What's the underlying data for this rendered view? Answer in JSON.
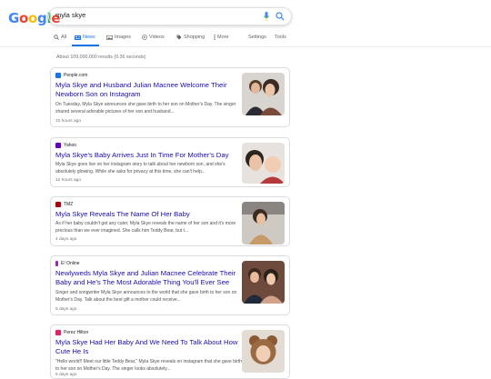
{
  "logo": {
    "letters": [
      "G",
      "o",
      "o",
      "g",
      "l",
      "e"
    ]
  },
  "search": {
    "query": "myla skye"
  },
  "tabs": [
    {
      "label": "All",
      "icon": "search-icon"
    },
    {
      "label": "News",
      "icon": "news-icon"
    },
    {
      "label": "Images",
      "icon": "image-icon"
    },
    {
      "label": "Videos",
      "icon": "video-icon"
    },
    {
      "label": "Shopping",
      "icon": "tag-icon"
    },
    {
      "label": "More",
      "icon": "more-dots-icon"
    },
    {
      "label": "Settings"
    },
    {
      "label": "Tools"
    }
  ],
  "colors": {
    "accent": "#1a73e8",
    "link": "#1a0dab"
  },
  "results_stats": "About 109,000,000 results (0.36 seconds)",
  "articles": [
    {
      "source": "People.com",
      "favicon_color": "#1a73e8",
      "title": "Myla Skye and Husband Julian Macnee Welcome Their Newborn Son on Instagram",
      "snippet": "On Tuesday, Myla Skye announces she gave birth to her son on Mother's Day. The singer shared several adorable pictures of her son and husband...",
      "time": "10 hours ago"
    },
    {
      "source": "Yahoo",
      "favicon_color": "#6001d2",
      "title": "Myla Skye's Baby Arrives Just In Time For Mother's Day",
      "snippet": "Myla Skye goes live on her instagram story to talk about her newborn son, and she's absolutely glowing. While she asks for privacy at this time, she can't help...",
      "time": "12 hours ago"
    },
    {
      "source": "TMZ",
      "favicon_color": "#b3000f",
      "title": "Myla Skye Reveals The Name Of Her Baby",
      "snippet": "As if her baby couldn't get any cuter, Myla Skye reveals the name of her son and it's more precious than we ever imagined. She calls him Teddy Bear, but t...",
      "time": "4 days ago"
    },
    {
      "source": "E! Online",
      "favicon_color": "#9c27b0",
      "title": "Newlyweds Myla Skye and Julian Macnee Celebrate Their Baby and He's The Most Adorable Thing You'll Ever See",
      "snippet": "Singer and songwriter Myla Skye announces to the world that she gave birth to her son on Mother's Day. Talk about the best gift a mother could receive...",
      "time": "5 days ago"
    },
    {
      "source": "Perez Hilton",
      "favicon_color": "#e91e63",
      "title": "Myla Skye Had Her Baby And We Need To Talk About How Cute He Is",
      "snippet": "\"Hello world!! Meet our little Teddy Bear,\" Myla Skye reveals on instagram that she gave birth to her son on Mother's Day. The singer looks absolutely...",
      "time": "6 days ago"
    }
  ]
}
